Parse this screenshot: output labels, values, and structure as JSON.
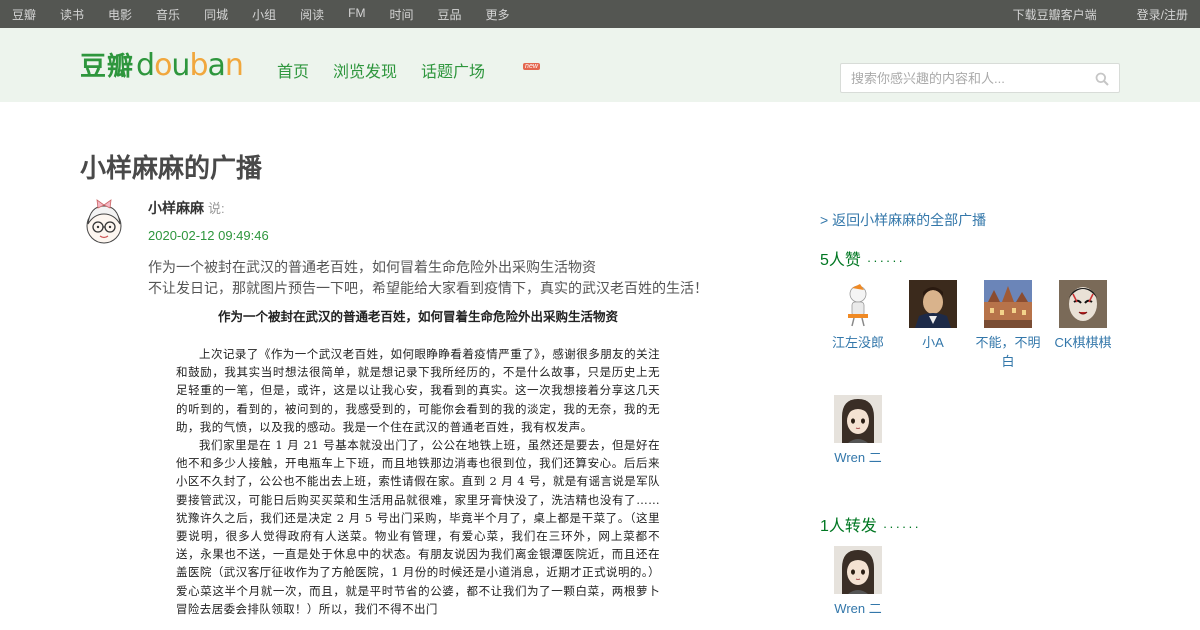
{
  "topnav": {
    "links": [
      "豆瓣",
      "读书",
      "电影",
      "音乐",
      "同城",
      "小组",
      "阅读",
      "FM",
      "时间",
      "豆品",
      "更多"
    ],
    "download": "下载豆瓣客户端",
    "login": "登录/注册"
  },
  "header": {
    "logo_cn": "豆瓣",
    "logo_en": "douban",
    "nav": [
      "首页",
      "浏览发现",
      "话题广场"
    ],
    "new_badge": "new",
    "search_placeholder": "搜索你感兴趣的内容和人..."
  },
  "post": {
    "page_title": "小样麻麻的广播",
    "author": "小样麻麻",
    "said": "说:",
    "timestamp": "2020-02-12 09:49:46",
    "text_line1": "作为一个被封在武汉的普通老百姓，如何冒着生命危险外出采购生活物资",
    "text_line2": "不让发日记，那就图片预告一下吧，希望能给大家看到疫情下，真实的武汉老百姓的生活！"
  },
  "article": {
    "title": "作为一个被封在武汉的普通老百姓，如何冒着生命危险外出采购生活物资",
    "para1": "上次记录了《作为一个武汉老百姓，如何眼睁睁看着疫情严重了》，感谢很多朋友的关注和鼓励，我其实当时想法很简单，就是想记录下我所经历的，不是什么故事，只是历史上无足轻重的一笔，但是，或许，这是以让我心安，我看到的真实。这一次我想接着分享这几天的听到的，看到的，被问到的，我感受到的，可能你会看到的我的淡定，我的无奈，我的无助，我的气愤，以及我的感动。我是一个住在武汉的普通老百姓，我有权发声。",
    "para2": "我们家里是在 1 月 21 号基本就没出门了，公公在地铁上班，虽然还是要去，但是好在他不和多少人接触，开电瓶车上下班，而且地铁那边消毒也很到位，我们还算安心。后后来小区不久封了，公公也不能出去上班，索性请假在家。直到 2 月 4 号，就是有谣言说是军队要接管武汉，可能日后购买买菜和生活用品就很难，家里牙膏快没了，洗洁精也没有了……犹豫许久之后，我们还是决定 2 月 5 号出门采购，毕竟半个月了，桌上都是干菜了。（这里要说明，很多人觉得政府有人送菜。物业有管理，有爱心菜，我们在三环外，网上菜都不送，永果也不送，一直是处于休息中的状态。有朋友说因为我们离金银潭医院近，而且还在盖医院（武汉客厅征收作为了方舱医院，1 月份的时候还是小道消息，近期才正式说明的。）爱心菜这半个月就一次，而且，就是平时节省的公婆，都不让我们为了一颗白菜，两根萝卜冒险去居委会排队领取！）所以，我们不得不出门"
  },
  "sidebar": {
    "back_link": "> 返回小样麻麻的全部广播",
    "likes_title": "5人赞",
    "reposts_title": "1人转发",
    "dots": "······",
    "likers": [
      "江左没郎",
      "小A",
      "不能，不明白",
      "CK棋棋棋",
      "Wren ⼆"
    ],
    "reposters": [
      "Wren ⼆"
    ]
  },
  "colors": {
    "topnav_bg": "#545652",
    "header_bg": "#edf4ed",
    "brand_green": "#2e963d",
    "link_blue": "#3377aa"
  }
}
